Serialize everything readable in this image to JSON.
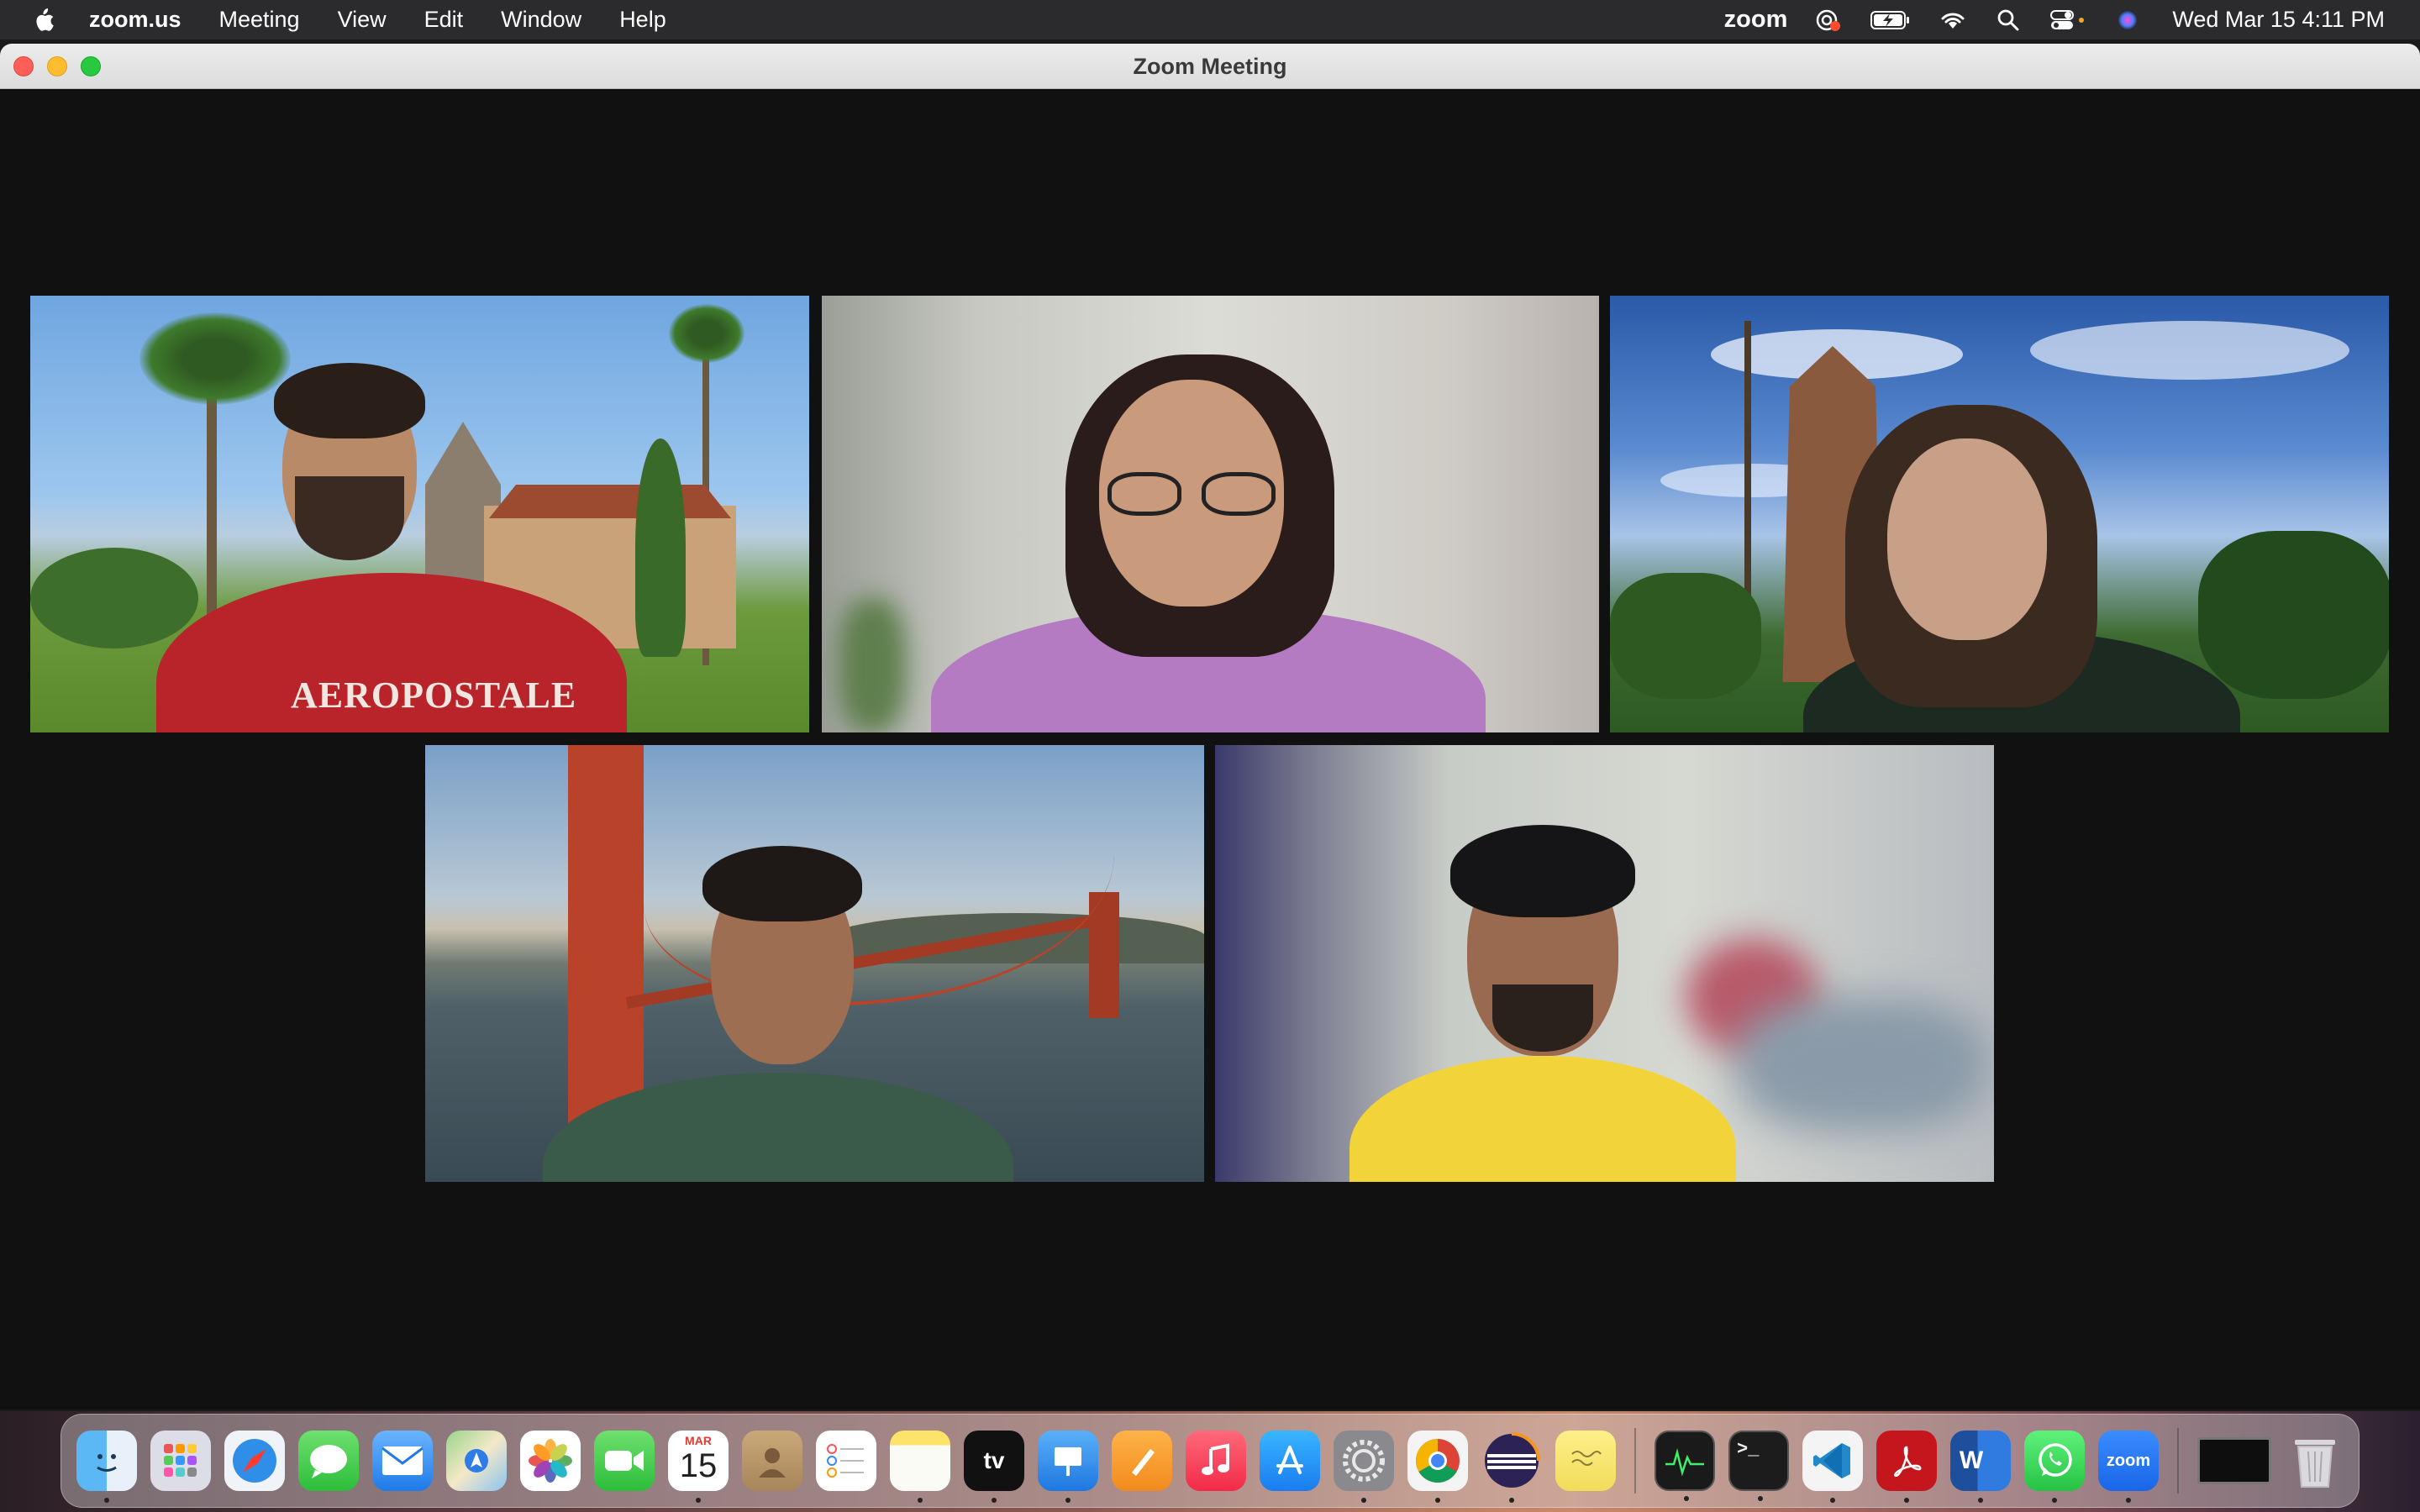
{
  "menubar": {
    "app_name": "zoom.us",
    "items": [
      "Meeting",
      "View",
      "Edit",
      "Window",
      "Help"
    ],
    "zoom_status": "zoom",
    "datetime": "Wed Mar 15  4:11 PM"
  },
  "window": {
    "title": "Zoom Meeting"
  },
  "participants": [
    {
      "shirt_text": "AEROPOSTALE",
      "background": "campus-palm-trees",
      "active_speaker": false
    },
    {
      "background": "blurred-room",
      "active_speaker": true
    },
    {
      "background": "painted-tower",
      "active_speaker": false
    },
    {
      "background": "golden-gate-bridge",
      "active_speaker": false
    },
    {
      "background": "blurred-room",
      "active_speaker": false
    }
  ],
  "dock": {
    "calendar_month": "MAR",
    "calendar_day": "15",
    "tv_label": "tv",
    "zoom_label": "zoom",
    "terminal_label": ">_",
    "word_label": "W",
    "items": [
      "finder",
      "launchpad",
      "safari",
      "messages",
      "mail",
      "maps",
      "photos",
      "facetime",
      "calendar",
      "contacts",
      "reminders",
      "notes",
      "apple-tv",
      "keynote",
      "pages",
      "music",
      "app-store",
      "system-preferences",
      "chrome",
      "eclipse",
      "stickies",
      "activity-monitor",
      "terminal",
      "vscode",
      "acrobat",
      "word",
      "whatsapp",
      "zoom",
      "window-preview",
      "trash"
    ]
  },
  "colors": {
    "active_speaker_border": "#5dd35d",
    "menubar_bg": "#2b2b2d",
    "window_bg": "#111111"
  }
}
